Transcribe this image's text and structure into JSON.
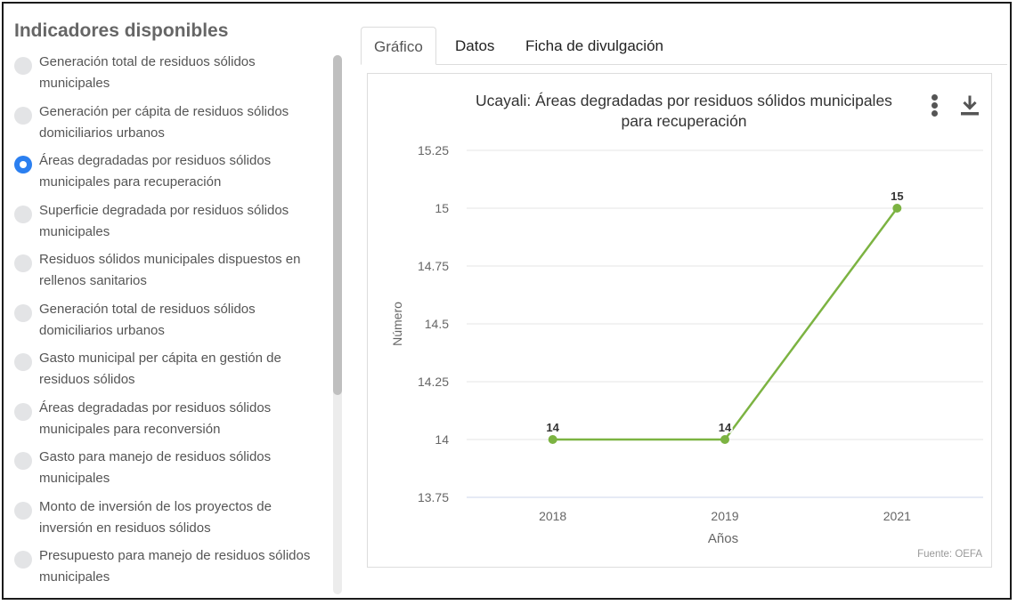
{
  "sidebar": {
    "title": "Indicadores disponibles",
    "items": [
      {
        "label": "Generación total de residuos sólidos municipales",
        "selected": false
      },
      {
        "label": "Generación per cápita de residuos sólidos domiciliarios urbanos",
        "selected": false
      },
      {
        "label": "Áreas degradadas por residuos sólidos municipales para recuperación",
        "selected": true
      },
      {
        "label": "Superficie degradada por residuos sólidos municipales",
        "selected": false
      },
      {
        "label": "Residuos sólidos municipales dispuestos en rellenos sanitarios",
        "selected": false
      },
      {
        "label": "Generación total de residuos sólidos domiciliarios urbanos",
        "selected": false
      },
      {
        "label": "Gasto municipal per cápita en gestión de residuos sólidos",
        "selected": false
      },
      {
        "label": "Áreas degradadas por residuos sólidos municipales para reconversión",
        "selected": false
      },
      {
        "label": "Gasto para manejo de residuos sólidos municipales",
        "selected": false
      },
      {
        "label": "Monto de inversión de los proyectos de inversión en residuos sólidos",
        "selected": false
      },
      {
        "label": "Presupuesto para manejo de residuos sólidos municipales",
        "selected": false
      }
    ]
  },
  "tabs": {
    "grafico": "Gráfico",
    "datos": "Datos",
    "ficha": "Ficha de divulgación",
    "active": "grafico"
  },
  "icons": {
    "menu": "vertical-dots-icon",
    "download": "download-icon"
  },
  "colors": {
    "series": "#7cb342",
    "radio_selected": "#2b7ff0",
    "gridline": "#e6e6e6",
    "axis_line": "#ccd6eb"
  },
  "chart_data": {
    "type": "line",
    "title_line1": "Ucayali: Áreas degradadas por residuos sólidos municipales",
    "title_line2": "para recuperación",
    "categories": [
      "2018",
      "2019",
      "2021"
    ],
    "values": [
      14,
      14,
      15
    ],
    "data_labels": [
      "14",
      "14",
      "15"
    ],
    "xlabel": "Años",
    "ylabel": "Número",
    "ylim": [
      13.75,
      15.25
    ],
    "yticks": [
      "15.25",
      "15",
      "14.75",
      "14.5",
      "14.25",
      "14",
      "13.75"
    ],
    "credit": "Fuente: OEFA",
    "grid": true,
    "legend": "none"
  }
}
